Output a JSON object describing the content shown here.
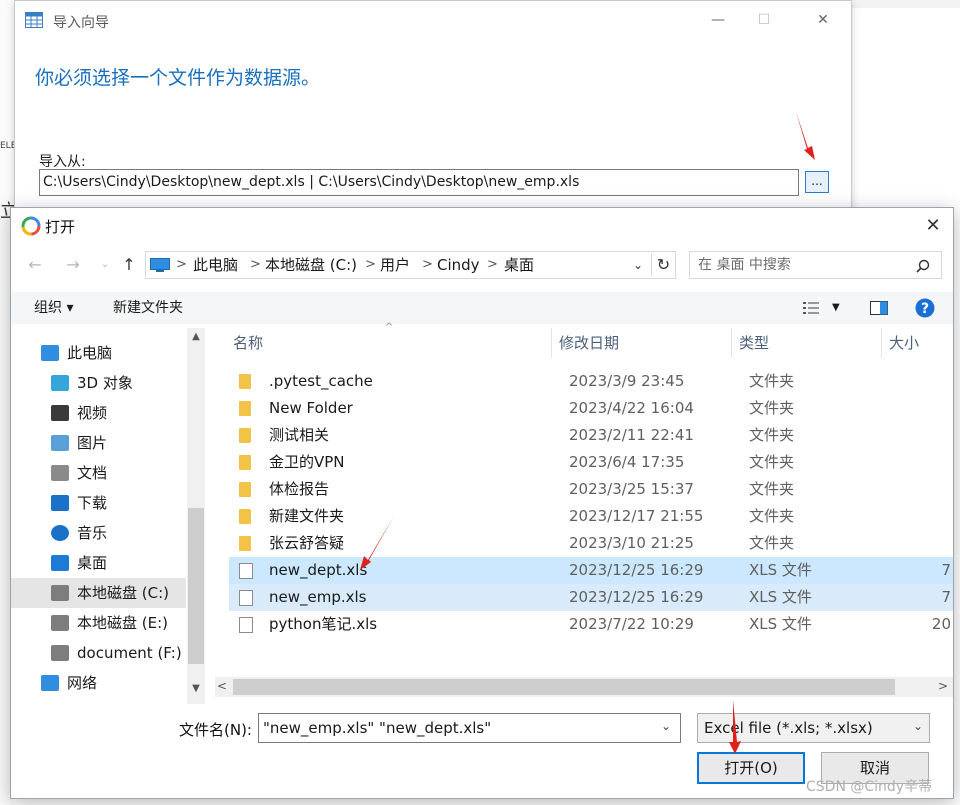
{
  "wizard": {
    "title": "导入向导",
    "heading": "你必须选择一个文件作为数据源。",
    "import_from_label": "导入从:",
    "path_value": "C:\\Users\\Cindy\\Desktop\\new_dept.xls | C:\\Users\\Cindy\\Desktop\\new_emp.xls",
    "browse_label": "...",
    "minimize_glyph": "—",
    "maximize_glyph": "☐",
    "close_glyph": "✕"
  },
  "dialog": {
    "title": "打开",
    "close_glyph": "✕",
    "address": [
      "此电脑",
      "本地磁盘 (C:)",
      "用户",
      "Cindy",
      "桌面"
    ],
    "search_placeholder": "在 桌面 中搜索",
    "toolbar": {
      "organize": "组织 ▾",
      "new_folder": "新建文件夹"
    },
    "nav_items": [
      {
        "label": "此电脑",
        "icon": "pc-icon"
      },
      {
        "label": "3D 对象",
        "icon": "3d-objects-icon"
      },
      {
        "label": "视频",
        "icon": "video-icon"
      },
      {
        "label": "图片",
        "icon": "pictures-icon"
      },
      {
        "label": "文档",
        "icon": "documents-icon"
      },
      {
        "label": "下载",
        "icon": "download-icon"
      },
      {
        "label": "音乐",
        "icon": "music-icon"
      },
      {
        "label": "桌面",
        "icon": "desktop-icon"
      },
      {
        "label": "本地磁盘 (C:)",
        "icon": "drive-icon"
      },
      {
        "label": "本地磁盘 (E:)",
        "icon": "drive-icon"
      },
      {
        "label": "document (F:)",
        "icon": "drive-icon"
      },
      {
        "label": "网络",
        "icon": "network-icon"
      }
    ],
    "columns": {
      "name": "名称",
      "date": "修改日期",
      "type": "类型",
      "size": "大小"
    },
    "files": [
      {
        "name": ".pytest_cache",
        "date": "2023/3/9 23:45",
        "type": "文件夹",
        "size": "",
        "kind": "folder"
      },
      {
        "name": "New Folder",
        "date": "2023/4/22 16:04",
        "type": "文件夹",
        "size": "",
        "kind": "folder"
      },
      {
        "name": "测试相关",
        "date": "2023/2/11 22:41",
        "type": "文件夹",
        "size": "",
        "kind": "folder"
      },
      {
        "name": "金卫的VPN",
        "date": "2023/6/4 17:35",
        "type": "文件夹",
        "size": "",
        "kind": "folder"
      },
      {
        "name": "体检报告",
        "date": "2023/3/25 15:37",
        "type": "文件夹",
        "size": "",
        "kind": "folder"
      },
      {
        "name": "新建文件夹",
        "date": "2023/12/17 21:55",
        "type": "文件夹",
        "size": "",
        "kind": "folder"
      },
      {
        "name": "张云舒答疑",
        "date": "2023/3/10 21:25",
        "type": "文件夹",
        "size": "",
        "kind": "folder"
      },
      {
        "name": "new_dept.xls",
        "date": "2023/12/25 16:29",
        "type": "XLS 文件",
        "size": "7",
        "kind": "file"
      },
      {
        "name": "new_emp.xls",
        "date": "2023/12/25 16:29",
        "type": "XLS 文件",
        "size": "7",
        "kind": "file"
      },
      {
        "name": "python笔记.xls",
        "date": "2023/7/22 10:29",
        "type": "XLS 文件",
        "size": "20",
        "kind": "file"
      }
    ],
    "filename_label": "文件名(N):",
    "filename_value": "\"new_emp.xls\" \"new_dept.xls\"",
    "filetype_value": "Excel file (*.xls; *.xlsx)",
    "open_button": "打开(O)",
    "cancel_button": "取消"
  },
  "watermark": "CSDN @Cindy辛蒂",
  "background_fragments": {
    "left_char": "立",
    "left_tag": "ELE"
  },
  "colors": {
    "accent": "#0078d7",
    "heading": "#1a6fbf",
    "selection": "#cce8ff",
    "arrow": "#e0201b"
  }
}
